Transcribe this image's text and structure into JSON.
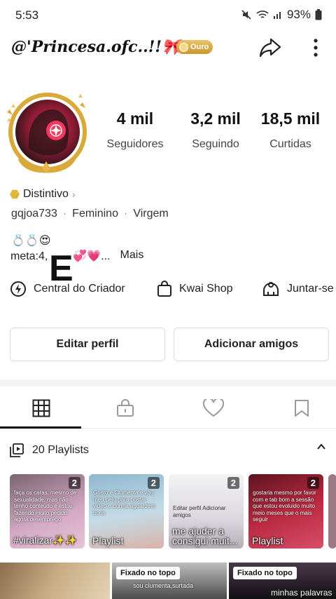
{
  "status": {
    "time": "5:53",
    "battery": "93%"
  },
  "profile": {
    "username": "@'Princesa.ofc..!!🎀💤",
    "tier_badge": "Ouro",
    "stats": [
      {
        "value": "4 mil",
        "label": "Seguidores"
      },
      {
        "value": "3,2 mil",
        "label": "Seguindo"
      },
      {
        "value": "18,5 mil",
        "label": "Curtidas"
      }
    ],
    "distintivo": "Distintivo",
    "handle": "gqjoa733",
    "gender": "Feminino",
    "sign": "Virgem",
    "bio_emojis": "💍💍😍",
    "bio_text": "meta:4,",
    "bio_tail": "💞💗...",
    "bio_more": "Mais",
    "overlay_letter": "E"
  },
  "quick_links": [
    {
      "label": "Central do Criador",
      "icon": "bolt-icon"
    },
    {
      "label": "Kwai Shop",
      "icon": "shopping-bag-icon"
    },
    {
      "label": "Juntar-se",
      "icon": "group-icon"
    }
  ],
  "actions": {
    "edit": "Editar perfil",
    "add_friends": "Adicionar amigos"
  },
  "tabs": [
    "grid-icon",
    "lock-icon",
    "heart-icon",
    "bookmark-icon"
  ],
  "playlists": {
    "label": "20 Playlists",
    "items": [
      {
        "caption": "#viralizar✨✨",
        "count": "2",
        "note": "faça os caras, mesmo de sexualidade, mas não tenho conteúdo e estou fazendo muito pedido agora desemprego",
        "color": "#c9a3b8"
      },
      {
        "caption": "Playlist",
        "count": "2",
        "note": "Gosto e Clumenta e vou meu pelo para postar video e durma aguardem bons",
        "color": "#9fc3d6"
      },
      {
        "caption": "me ajuder a consigui muit...",
        "count": "2",
        "note": "Editar perfil   Adicionar amigos",
        "color": "#e8e4ea"
      },
      {
        "caption": "Playlist",
        "count": "2",
        "note": "gostaria mesmo por favor com e tab bom a sessão que estou evoluido muito meio meses que o mais seguir",
        "color": "#b0283c"
      }
    ]
  },
  "videos": [
    {
      "pinned": "",
      "text": "",
      "color": "#b49470"
    },
    {
      "pinned": "Fixado no topo",
      "text": "sou clumenta,surtada",
      "color": "#5a5a5a"
    },
    {
      "pinned": "Fixado no topo",
      "text": "minhas palavras",
      "color": "#2a1e2a"
    }
  ]
}
